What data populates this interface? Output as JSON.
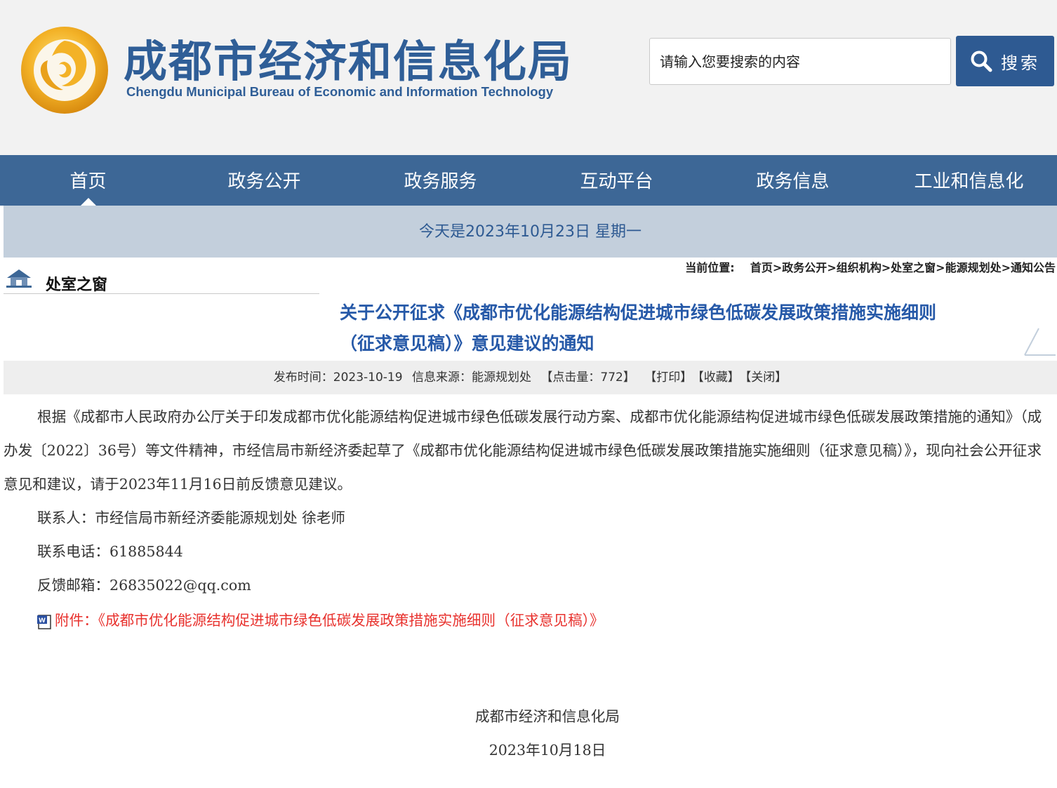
{
  "header": {
    "title_cn": "成都市经济和信息化局",
    "title_en": "Chengdu Municipal Bureau of Economic and Information Technology",
    "search_placeholder": "请输入您要搜索的内容",
    "search_button": "搜索"
  },
  "nav": {
    "items": [
      "首页",
      "政务公开",
      "政务服务",
      "互动平台",
      "政务信息",
      "工业和信息化"
    ]
  },
  "date_bar": "今天是2023年10月23日 星期一",
  "section": {
    "title": "处室之窗"
  },
  "breadcrumb": {
    "label": "当前位置:",
    "items": [
      "首页",
      "政务公开",
      "组织机构",
      "处室之窗",
      "能源规划处",
      "通知公告"
    ]
  },
  "article": {
    "title_line1": "关于公开征求《成都市优化能源结构促进城市绿色低碳发展政策措施实施细则",
    "title_line2": "（征求意见稿）》意见建议的通知",
    "meta": {
      "publish": "发布时间：2023-10-19",
      "source": "信息来源：能源规划处",
      "hits": "【点击量：772】",
      "print": "【打印】",
      "favorite": "【收藏】",
      "close": "【关闭】"
    },
    "paragraph": "根据《成都市人民政府办公厅关于印发成都市优化能源结构促进城市绿色低碳发展行动方案、成都市优化能源结构促进城市绿色低碳发展政策措施的通知》（成办发〔2022〕36号）等文件精神，市经信局市新经济委起草了《成都市优化能源结构促进城市绿色低碳发展政策措施实施细则（征求意见稿）》，现向社会公开征求意见和建议，请于2023年11月16日前反馈意见建议。",
    "contact": "联系人：市经信局市新经济委能源规划处 徐老师",
    "phone": "联系电话：61885844",
    "email": "反馈邮箱：26835022@qq.com",
    "attachment": "附件：《成都市优化能源结构促进城市绿色低碳发展政策措施实施细则（征求意见稿）》",
    "signature": "成都市经济和信息化局",
    "sign_date": "2023年10月18日"
  },
  "colors": {
    "brand_blue": "#2f5e97",
    "nav_bg": "#3d6796",
    "date_bar_bg": "#c3cfdc",
    "title_blue": "#2659a8",
    "attachment_red": "#e8322e"
  }
}
